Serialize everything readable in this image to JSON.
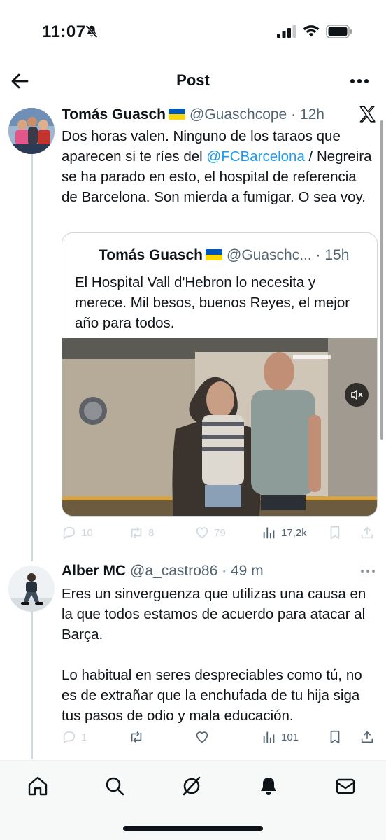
{
  "status_bar": {
    "time": "11:07"
  },
  "header": {
    "title": "Post"
  },
  "tweet": {
    "author_name": "Tomás Guasch",
    "handle": "@Guaschcope",
    "separator": " · ",
    "time": "12h",
    "text_before": "Dos horas valen. Ninguno de los taraos que aparecen si te ríes del ",
    "mention": "@FCBarcelona",
    "text_after": " / Negreira se ha parado en esto, el hospital de referencia de Barcelona. Son mierda a fumigar. O sea voy.",
    "quote": {
      "author_name": "Tomás Guasch",
      "handle": "@Guaschc...",
      "separator": " · ",
      "time": "15h",
      "text": "El Hospital Vall d'Hebron lo necesita y merece. Mil besos, buenos Reyes, el mejor año para todos."
    },
    "stats": {
      "replies": "10",
      "reposts": "8",
      "likes": "79",
      "views": "17,2k"
    }
  },
  "reply": {
    "author_name": "Alber MC",
    "handle": "@a_castro86",
    "separator": " · ",
    "time": "49 m",
    "paragraph1": "Eres un sinverguenza que utilizas una causa en la que todos estamos de acuerdo para atacar al Barça.",
    "paragraph2": "Lo habitual en seres despreciables como tú, no es de extrañar que la enchufada de tu hija siga tus pasos de odio y mala educación.",
    "stats": {
      "replies": "1",
      "views": "101"
    }
  },
  "colors": {
    "accent": "#1d9bf0",
    "text": "#0f1419",
    "secondary": "#536471",
    "border": "#cfd9de"
  },
  "icons": [
    "bell-off-icon",
    "signal-icon",
    "wifi-icon",
    "battery-icon",
    "back-arrow-icon",
    "more-icon",
    "x-logo-icon",
    "reply-icon",
    "repost-icon",
    "like-icon",
    "views-icon",
    "bookmark-icon",
    "share-icon",
    "mute-icon",
    "home-icon",
    "search-icon",
    "grok-icon",
    "notifications-icon",
    "messages-icon"
  ]
}
